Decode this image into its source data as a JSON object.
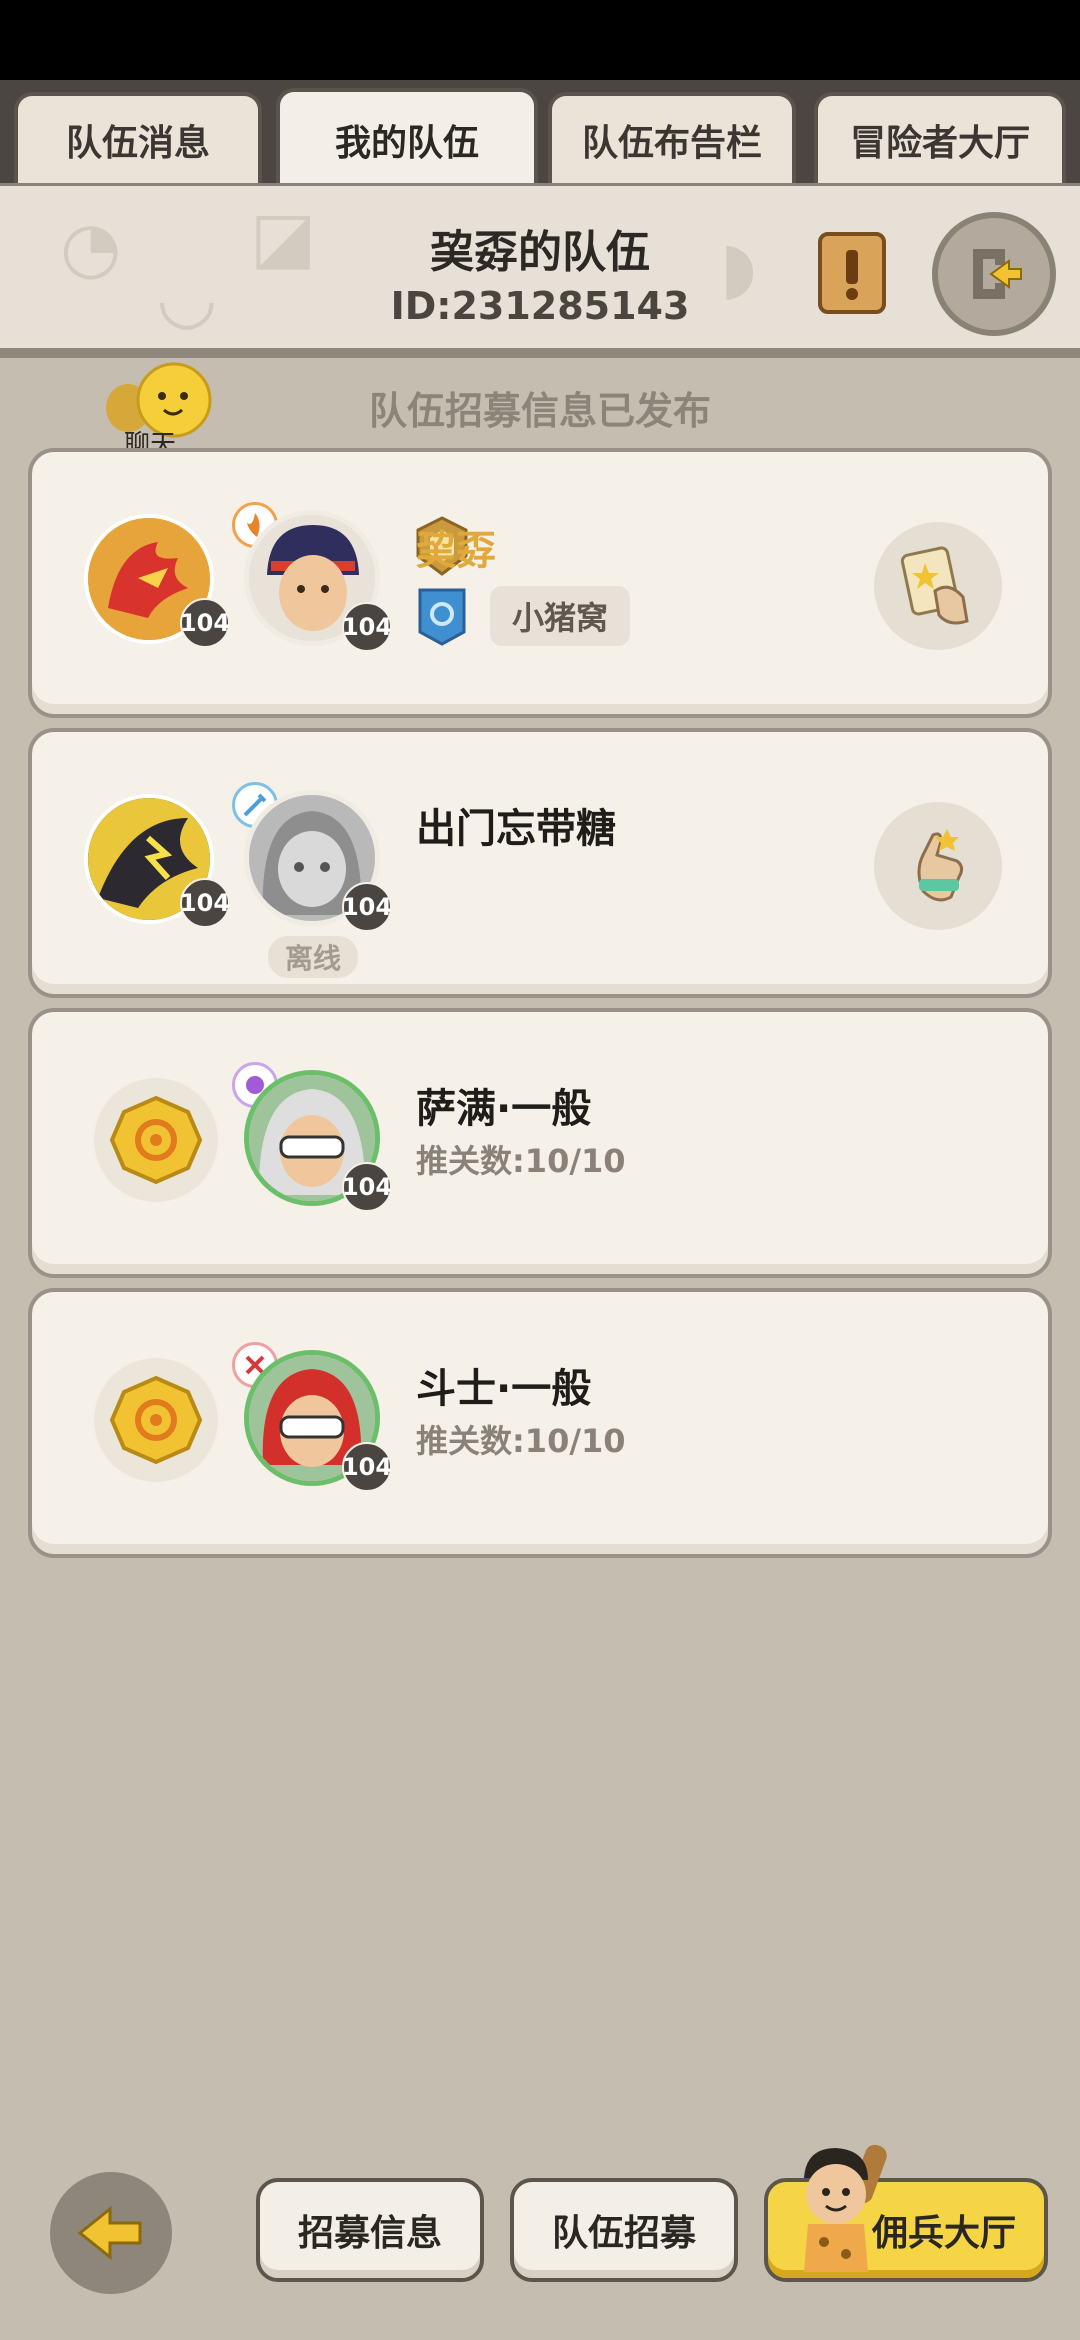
{
  "tabs": [
    {
      "label": "队伍消息"
    },
    {
      "label": "我的队伍"
    },
    {
      "label": "队伍布告栏"
    },
    {
      "label": "冒险者大厅"
    }
  ],
  "header": {
    "team_name": "巭孬的队伍",
    "team_id": "ID:231285143"
  },
  "chat": {
    "label": "聊天"
  },
  "notice": "队伍招募信息已发布",
  "members": [
    {
      "name": "巭孬",
      "guild": "小猪窝",
      "pet_level": "104",
      "level": "104"
    },
    {
      "name": "出门忘带糖",
      "pet_level": "104",
      "level": "104",
      "status": "离线"
    },
    {
      "name": "萨满·一般",
      "stages": "推关数:10/10",
      "level": "104"
    },
    {
      "name": "斗士·一般",
      "stages": "推关数:10/10",
      "level": "104"
    }
  ],
  "bottom": {
    "recruit_info": "招募信息",
    "team_recruit": "队伍招募",
    "mercenary_hall": "佣兵大厅"
  },
  "colors": {
    "name_highlight": "#e0a93a",
    "gold_button": "#f5d445"
  }
}
